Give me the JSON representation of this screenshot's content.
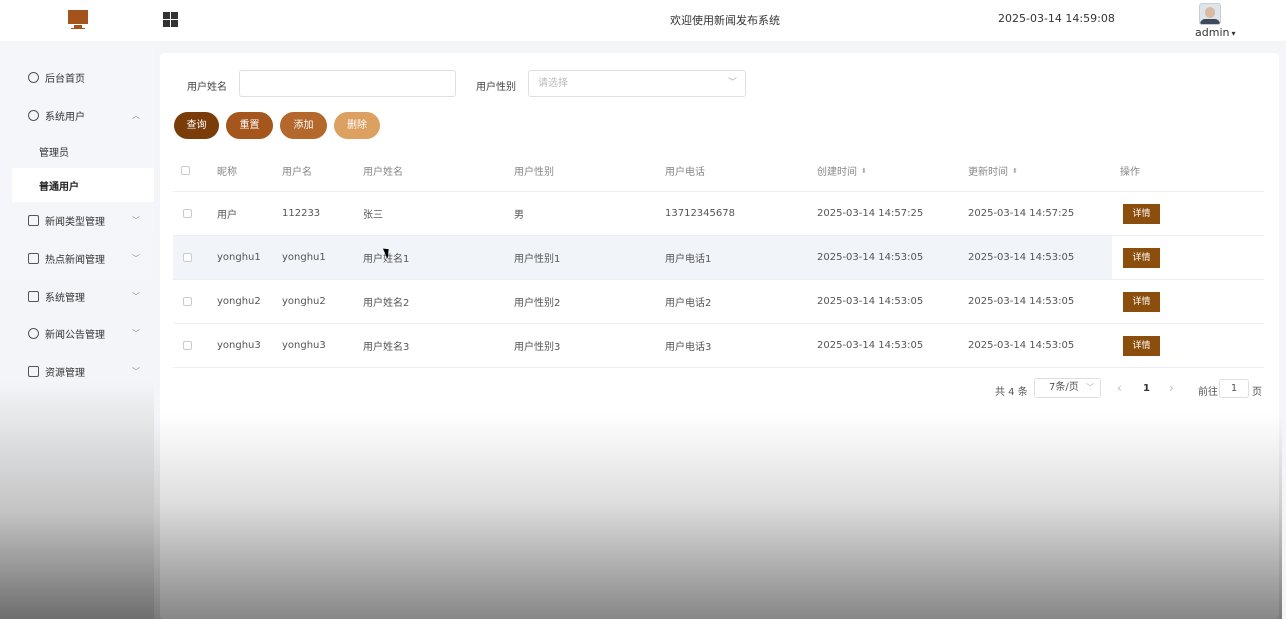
{
  "header": {
    "system_title": "欢迎使用新闻发布系统",
    "datetime": "2025-03-14 14:59:08",
    "username": "admin"
  },
  "sidebar": {
    "items": [
      {
        "label": "后台首页",
        "icon": "pie-chart-icon"
      },
      {
        "label": "系统用户",
        "icon": "user-icon",
        "expanded": true,
        "children": [
          {
            "label": "管理员"
          },
          {
            "label": "普通用户",
            "active": true
          }
        ]
      },
      {
        "label": "新闻类型管理",
        "icon": "list-icon"
      },
      {
        "label": "热点新闻管理",
        "icon": "list-icon"
      },
      {
        "label": "系统管理",
        "icon": "folder-icon"
      },
      {
        "label": "新闻公告管理",
        "icon": "notice-icon"
      },
      {
        "label": "资源管理",
        "icon": "box-icon"
      }
    ]
  },
  "filters": {
    "name_label": "用户姓名",
    "name_value": "",
    "gender_label": "用户性别",
    "gender_placeholder": "请选择"
  },
  "buttons": {
    "query": "查询",
    "reset": "重置",
    "add": "添加",
    "delete": "删除"
  },
  "colors": {
    "primary": "#7a3d0a",
    "reset": "#a5561c",
    "add": "#b4682b",
    "delete": "#dca060",
    "detail": "#8c4e0c"
  },
  "table": {
    "columns": [
      "昵称",
      "用户名",
      "用户姓名",
      "用户性别",
      "用户电话",
      "创建时间",
      "更新时间",
      "操作"
    ],
    "rows": [
      {
        "nickname": "用户",
        "username": "112233",
        "realname": "张三",
        "gender": "男",
        "phone": "13712345678",
        "created": "2025-03-14 14:57:25",
        "updated": "2025-03-14 14:57:25",
        "action": "详情"
      },
      {
        "nickname": "yonghu1",
        "username": "yonghu1",
        "realname": "用户姓名1",
        "gender": "用户性别1",
        "phone": "用户电话1",
        "created": "2025-03-14 14:53:05",
        "updated": "2025-03-14 14:53:05",
        "action": "详情"
      },
      {
        "nickname": "yonghu2",
        "username": "yonghu2",
        "realname": "用户姓名2",
        "gender": "用户性别2",
        "phone": "用户电话2",
        "created": "2025-03-14 14:53:05",
        "updated": "2025-03-14 14:53:05",
        "action": "详情"
      },
      {
        "nickname": "yonghu3",
        "username": "yonghu3",
        "realname": "用户姓名3",
        "gender": "用户性别3",
        "phone": "用户电话3",
        "created": "2025-03-14 14:53:05",
        "updated": "2025-03-14 14:53:05",
        "action": "详情"
      }
    ]
  },
  "pagination": {
    "total": "共 4 条",
    "page_size": "7条/页",
    "prev": "‹",
    "current_page": "1",
    "next": "›",
    "goto_label": "前往",
    "goto_value": "1",
    "page_suffix": "页"
  }
}
